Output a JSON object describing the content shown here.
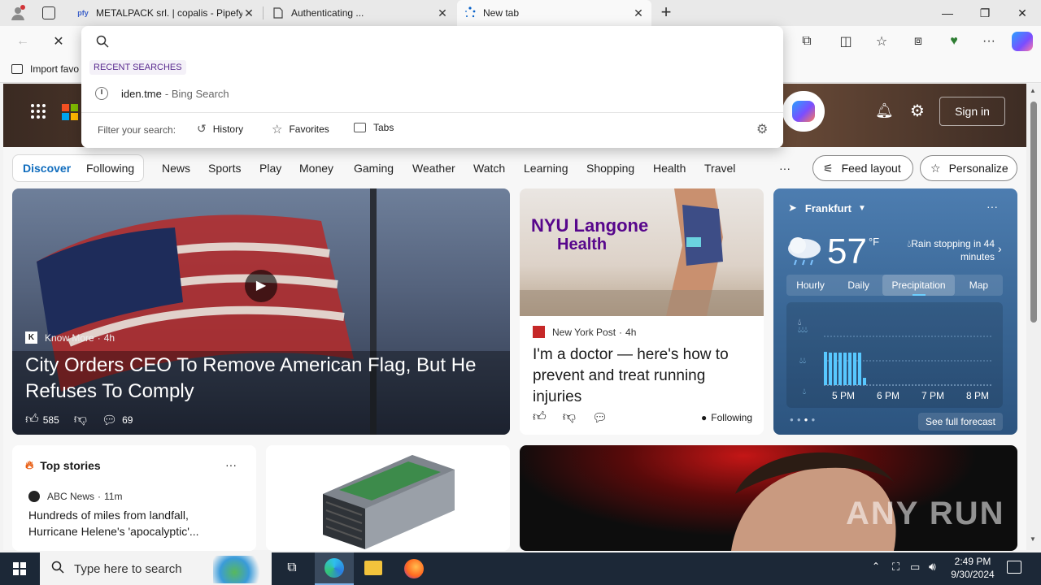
{
  "browser": {
    "tabs": [
      {
        "title": "METALPACK srl. | copalis - Pipefy",
        "favicon": "pfy"
      },
      {
        "title": "Authenticating ...",
        "favicon": "page-icon"
      },
      {
        "title": "New tab",
        "favicon": "loading-icon"
      }
    ],
    "new_tab_label": "+",
    "favorites_bar": {
      "import_label": "Import favo"
    }
  },
  "omnibox": {
    "recent_heading": "RECENT SEARCHES",
    "recent_item": {
      "query": "iden.tme",
      "suffix": " - Bing Search"
    },
    "filter_label": "Filter your search:",
    "filters": [
      "History",
      "Favorites",
      "Tabs"
    ]
  },
  "header": {
    "sign_in": "Sign in"
  },
  "nav": {
    "discover": "Discover",
    "following": "Following",
    "items": [
      "News",
      "Sports",
      "Play",
      "Money",
      "Gaming",
      "Weather",
      "Watch",
      "Learning",
      "Shopping",
      "Health",
      "Travel"
    ],
    "more": "···",
    "feed_layout": "Feed layout",
    "personalize": "Personalize"
  },
  "hero_story": {
    "source": "Know More",
    "age": "4h",
    "headline": "City Orders CEO To Remove American Flag, But He Refuses To Comply",
    "likes": "585",
    "comments": "69"
  },
  "second_story": {
    "source": "New York Post",
    "age": "4h",
    "headline": "I'm a doctor — here's how to prevent and treat running injuries",
    "logo_line1": "NYU Langone",
    "logo_line2": "Health",
    "following": "Following"
  },
  "weather": {
    "city": "Frankfurt",
    "temp": "57",
    "unit": "°F",
    "alert": "Rain stopping in 44 minutes",
    "tabs": [
      "Hourly",
      "Daily",
      "Precipitation",
      "Map"
    ],
    "active_tab": "Precipitation",
    "times": [
      "5 PM",
      "6 PM",
      "7 PM",
      "8 PM"
    ],
    "see_forecast": "See full forecast",
    "more": "···"
  },
  "top_stories": {
    "heading": "Top stories",
    "source": "ABC News",
    "age": "11m",
    "headline": "Hundreds of miles from landfall, Hurricane Helene's 'apocalyptic'...",
    "more": "···"
  },
  "watermark": "ANY RUN",
  "taskbar": {
    "search_placeholder": "Type here to search",
    "time": "2:49 PM",
    "date": "9/30/2024"
  }
}
